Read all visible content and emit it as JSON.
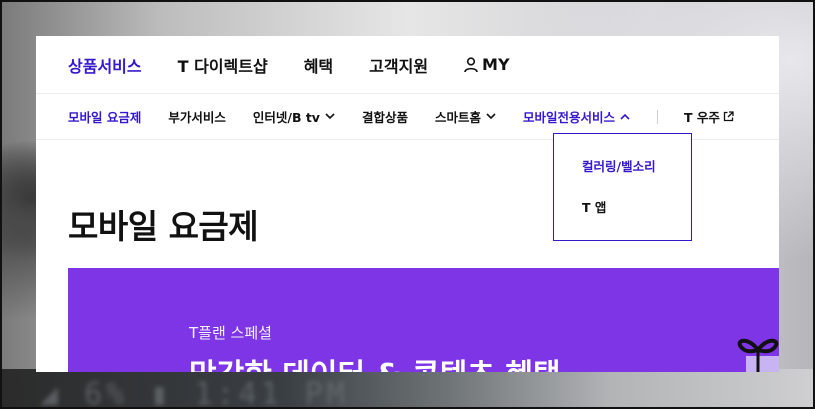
{
  "gnb": {
    "items": [
      {
        "label": "상품서비스"
      },
      {
        "label": "T 다이렉트샵"
      },
      {
        "label": "혜택"
      },
      {
        "label": "고객지원"
      },
      {
        "label": "MY"
      }
    ]
  },
  "lnb": {
    "items": [
      {
        "label": "모바일 요금제"
      },
      {
        "label": "부가서비스"
      },
      {
        "label": "인터넷/B tv"
      },
      {
        "label": "결합상품"
      },
      {
        "label": "스마트홈"
      },
      {
        "label": "모바일전용서비스"
      },
      {
        "label": "T 우주"
      }
    ]
  },
  "dropdown": {
    "items": [
      {
        "label": "컬러링/벨소리"
      },
      {
        "label": "T 앱"
      }
    ]
  },
  "main": {
    "title": "모바일 요금제",
    "banner": {
      "eyebrow": "T플랜 스페셜",
      "heading": "막강한 데이터 & 콘텐츠 혜택"
    }
  },
  "colors": {
    "accent": "#3617ce",
    "banner_bg": "#7d35e6"
  },
  "icons": [
    "user-icon",
    "chevron-down-icon",
    "chevron-up-icon",
    "external-link-icon",
    "gift-ribbon-icon"
  ]
}
